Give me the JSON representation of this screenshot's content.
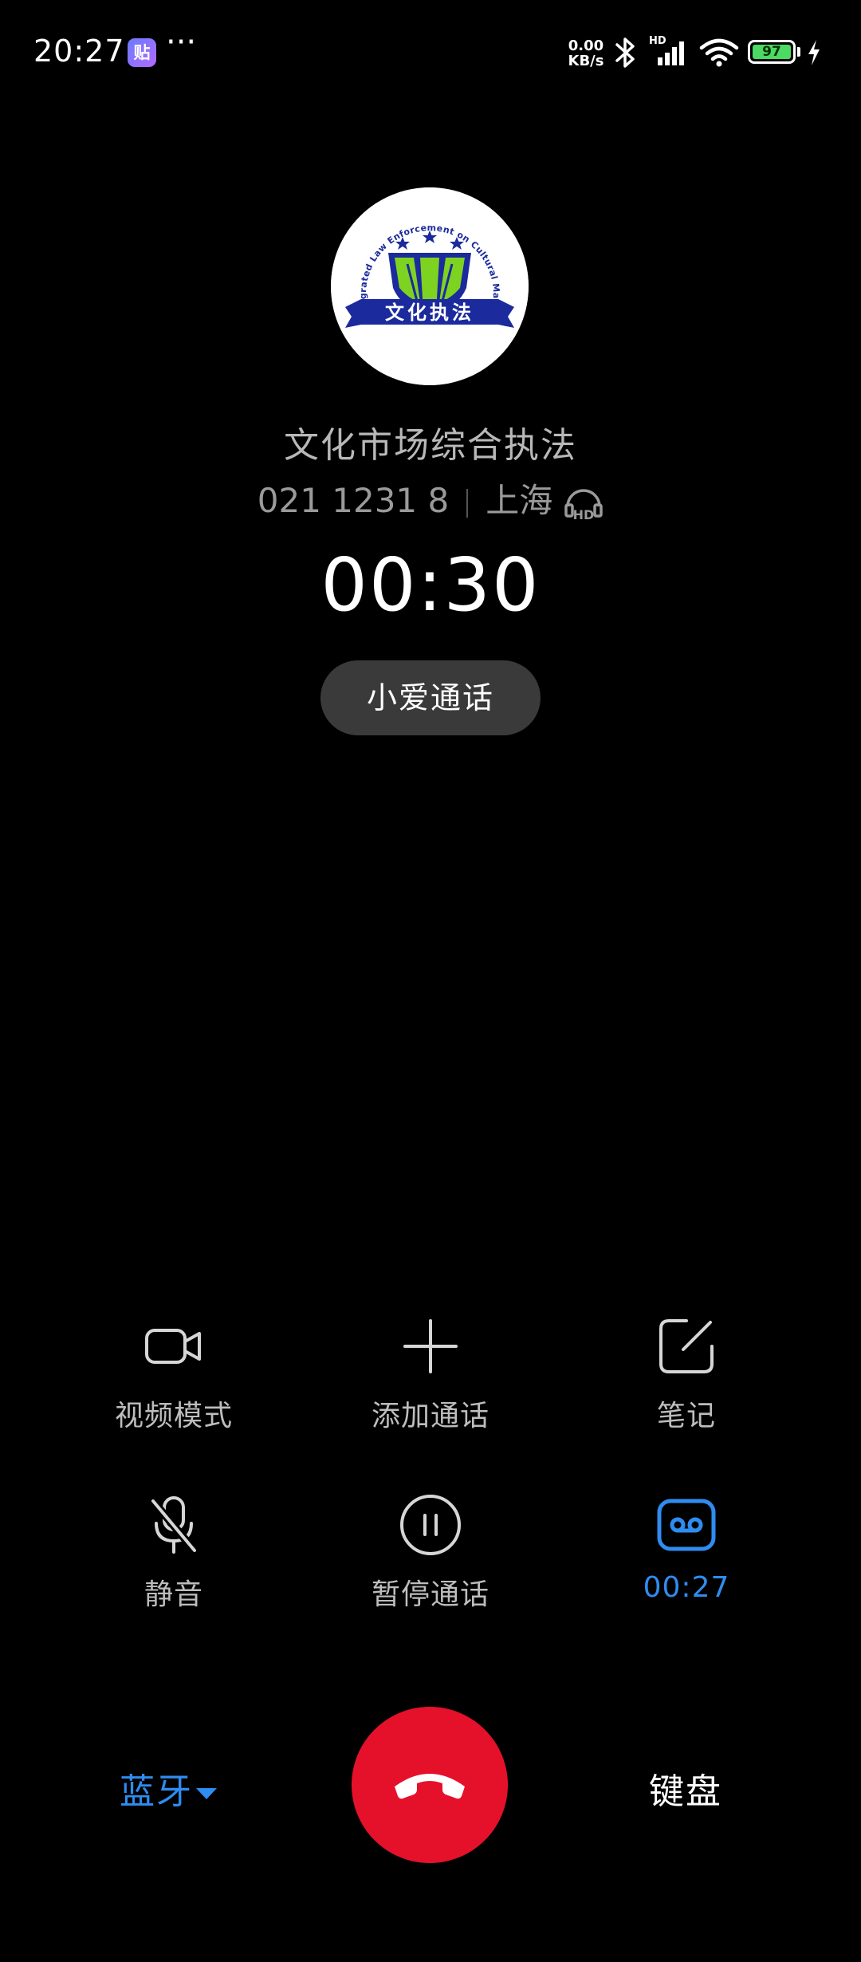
{
  "status_bar": {
    "time": "20:27",
    "app_badge": "贴",
    "more": "···",
    "speed_value": "0.00",
    "speed_unit": "KB/s",
    "signal_badge": "HD",
    "battery_level": "97",
    "battery_fraction": 0.97,
    "icons": [
      "app-notification-icon",
      "bluetooth-icon",
      "signal-icon",
      "wifi-icon",
      "battery-icon",
      "charging-icon"
    ]
  },
  "caller": {
    "avatar_logo_text": "文化执法",
    "avatar_logo_ring_text": "Integrated Law Enforcement on Cultural Market",
    "name": "文化市场综合执法",
    "number": "021 1231 8",
    "location": "上海",
    "hd_icon": "hd-voice-icon"
  },
  "call": {
    "timer": "00:30",
    "assistant_label": "小爱通话"
  },
  "controls": {
    "video": {
      "label": "视频模式",
      "icon": "video-camera-icon"
    },
    "add_call": {
      "label": "添加通话",
      "icon": "plus-icon"
    },
    "notes": {
      "label": "笔记",
      "icon": "note-edit-icon"
    },
    "mute": {
      "label": "静音",
      "icon": "microphone-off-icon"
    },
    "hold": {
      "label": "暂停通话",
      "icon": "pause-icon"
    },
    "record": {
      "label": "00:27",
      "icon": "recording-icon",
      "active": true
    }
  },
  "bottom": {
    "bluetooth_label": "蓝牙",
    "end_call_icon": "hang-up-icon",
    "keypad_label": "键盘"
  },
  "colors": {
    "background": "#000000",
    "accent_blue": "#2f8cf0",
    "end_call_red": "#e5112a",
    "pill_gray": "#3a3a3a",
    "battery_green": "#4cd964"
  }
}
